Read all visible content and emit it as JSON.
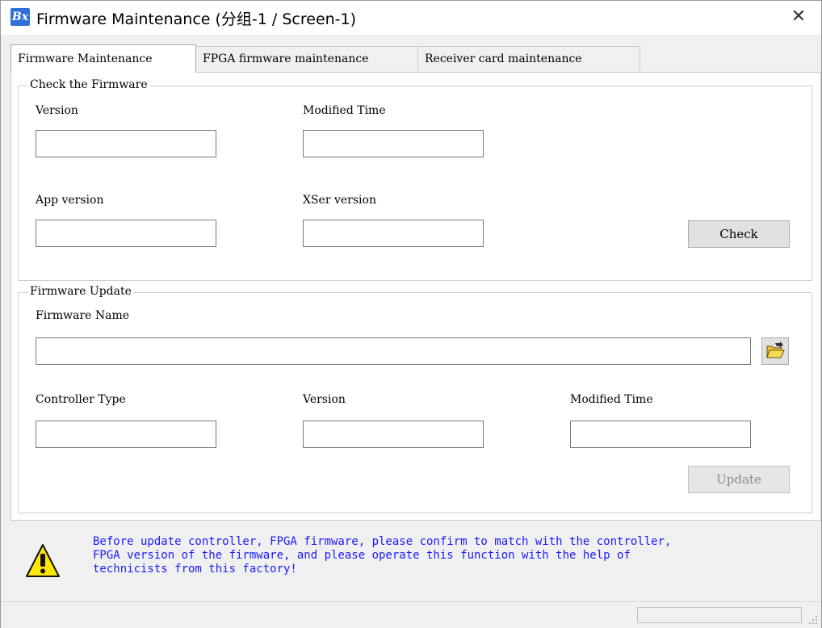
{
  "window": {
    "app_icon_text": "Bx",
    "title": "Firmware Maintenance  (分组-1 / Screen-1)",
    "close_glyph": "✕"
  },
  "tabs": [
    {
      "label": "Firmware Maintenance",
      "active": true
    },
    {
      "label": "FPGA firmware maintenance",
      "active": false
    },
    {
      "label": "Receiver card maintenance",
      "active": false
    }
  ],
  "check_group": {
    "legend": "Check the Firmware",
    "version_label": "Version",
    "version_value": "",
    "modified_time_label": "Modified Time",
    "modified_time_value": "",
    "app_version_label": "App version",
    "app_version_value": "",
    "xser_version_label": "XSer version",
    "xser_version_value": "",
    "check_button": "Check"
  },
  "update_group": {
    "legend": "Firmware Update",
    "firmware_name_label": "Firmware Name",
    "firmware_name_value": "",
    "browse_icon": "open-folder-icon",
    "controller_type_label": "Controller Type",
    "controller_type_value": "",
    "version_label": "Version",
    "version_value": "",
    "modified_time_label": "Modified Time",
    "modified_time_value": "",
    "update_button": "Update",
    "update_enabled": false
  },
  "warning": {
    "icon": "warning-icon",
    "text": "Before update controller, FPGA firmware, please confirm to match with the controller,\nFPGA version of the firmware, and please operate this function with the help of\ntechnicists from this factory!",
    "color": "#1a1aff"
  },
  "colors": {
    "accent": "#2f6fd6",
    "warning_yellow": "#ffe600"
  }
}
